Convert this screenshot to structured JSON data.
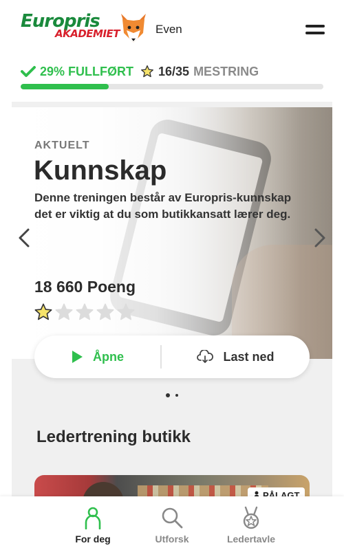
{
  "header": {
    "logo_main": "Europris",
    "logo_sub": "AKADEMIET",
    "username": "Even"
  },
  "progress": {
    "percent_label": "29% FULLFØRT",
    "completed_fraction": 0.29,
    "mastery_count": "16/35",
    "mastery_label": "MESTRING"
  },
  "hero": {
    "tag": "AKTUELT",
    "title": "Kunnskap",
    "description": "Denne treningen består av Europris-kunnskap det er viktig at du som butikkansatt lærer deg.",
    "points": "18 660 Poeng",
    "stars_filled": 1,
    "stars_total": 5,
    "open_label": "Åpne",
    "download_label": "Last ned"
  },
  "carousel": {
    "slide_count": 2,
    "active_index": 0
  },
  "section": {
    "title": "Ledertrening butikk",
    "card_badge": "PÅLAGT"
  },
  "bottom_nav": {
    "items": [
      {
        "label": "For deg",
        "icon": "person-icon",
        "active": true
      },
      {
        "label": "Utforsk",
        "icon": "search-icon",
        "active": false
      },
      {
        "label": "Ledertavle",
        "icon": "medal-icon",
        "active": false
      }
    ]
  },
  "colors": {
    "accent_green": "#2fbf4d",
    "brand_green": "#1a8a3c",
    "brand_red": "#d8202c"
  }
}
